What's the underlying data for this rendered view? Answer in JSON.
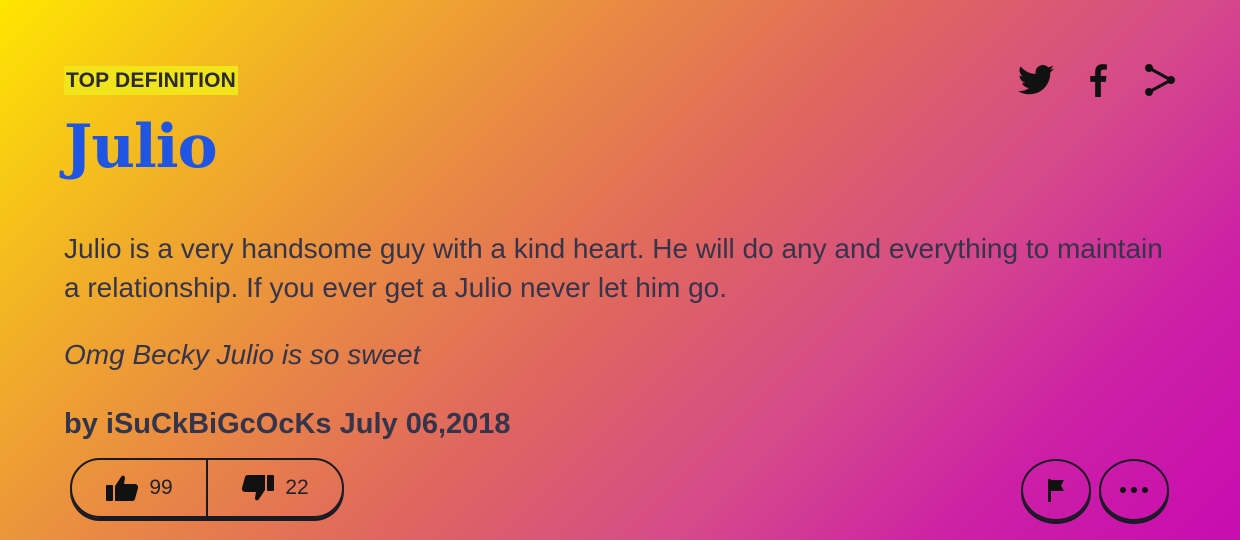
{
  "definition": {
    "badge": "TOP DEFINITION",
    "word": "Julio",
    "meaning": "Julio is a very handsome guy with a kind heart. He will do any and everything to maintain a relationship. If you ever get a Julio never let him go.",
    "example": "Omg Becky Julio is so sweet",
    "by_prefix": "by",
    "author": "iSuCkBiGcOcKs",
    "date": "July 06,2018"
  },
  "share": {
    "icons": [
      "twitter-icon",
      "facebook-icon",
      "share-icon"
    ]
  },
  "votes": {
    "up": "99",
    "down": "22"
  },
  "actions": {
    "icons": [
      "flag-icon",
      "more-dots-icon"
    ]
  },
  "colors": {
    "word": "#1f55e0",
    "badge_bg": "#f2e41a",
    "text": "#34344a",
    "gradient_start": "#ffe600",
    "gradient_end": "#c80cb0"
  }
}
